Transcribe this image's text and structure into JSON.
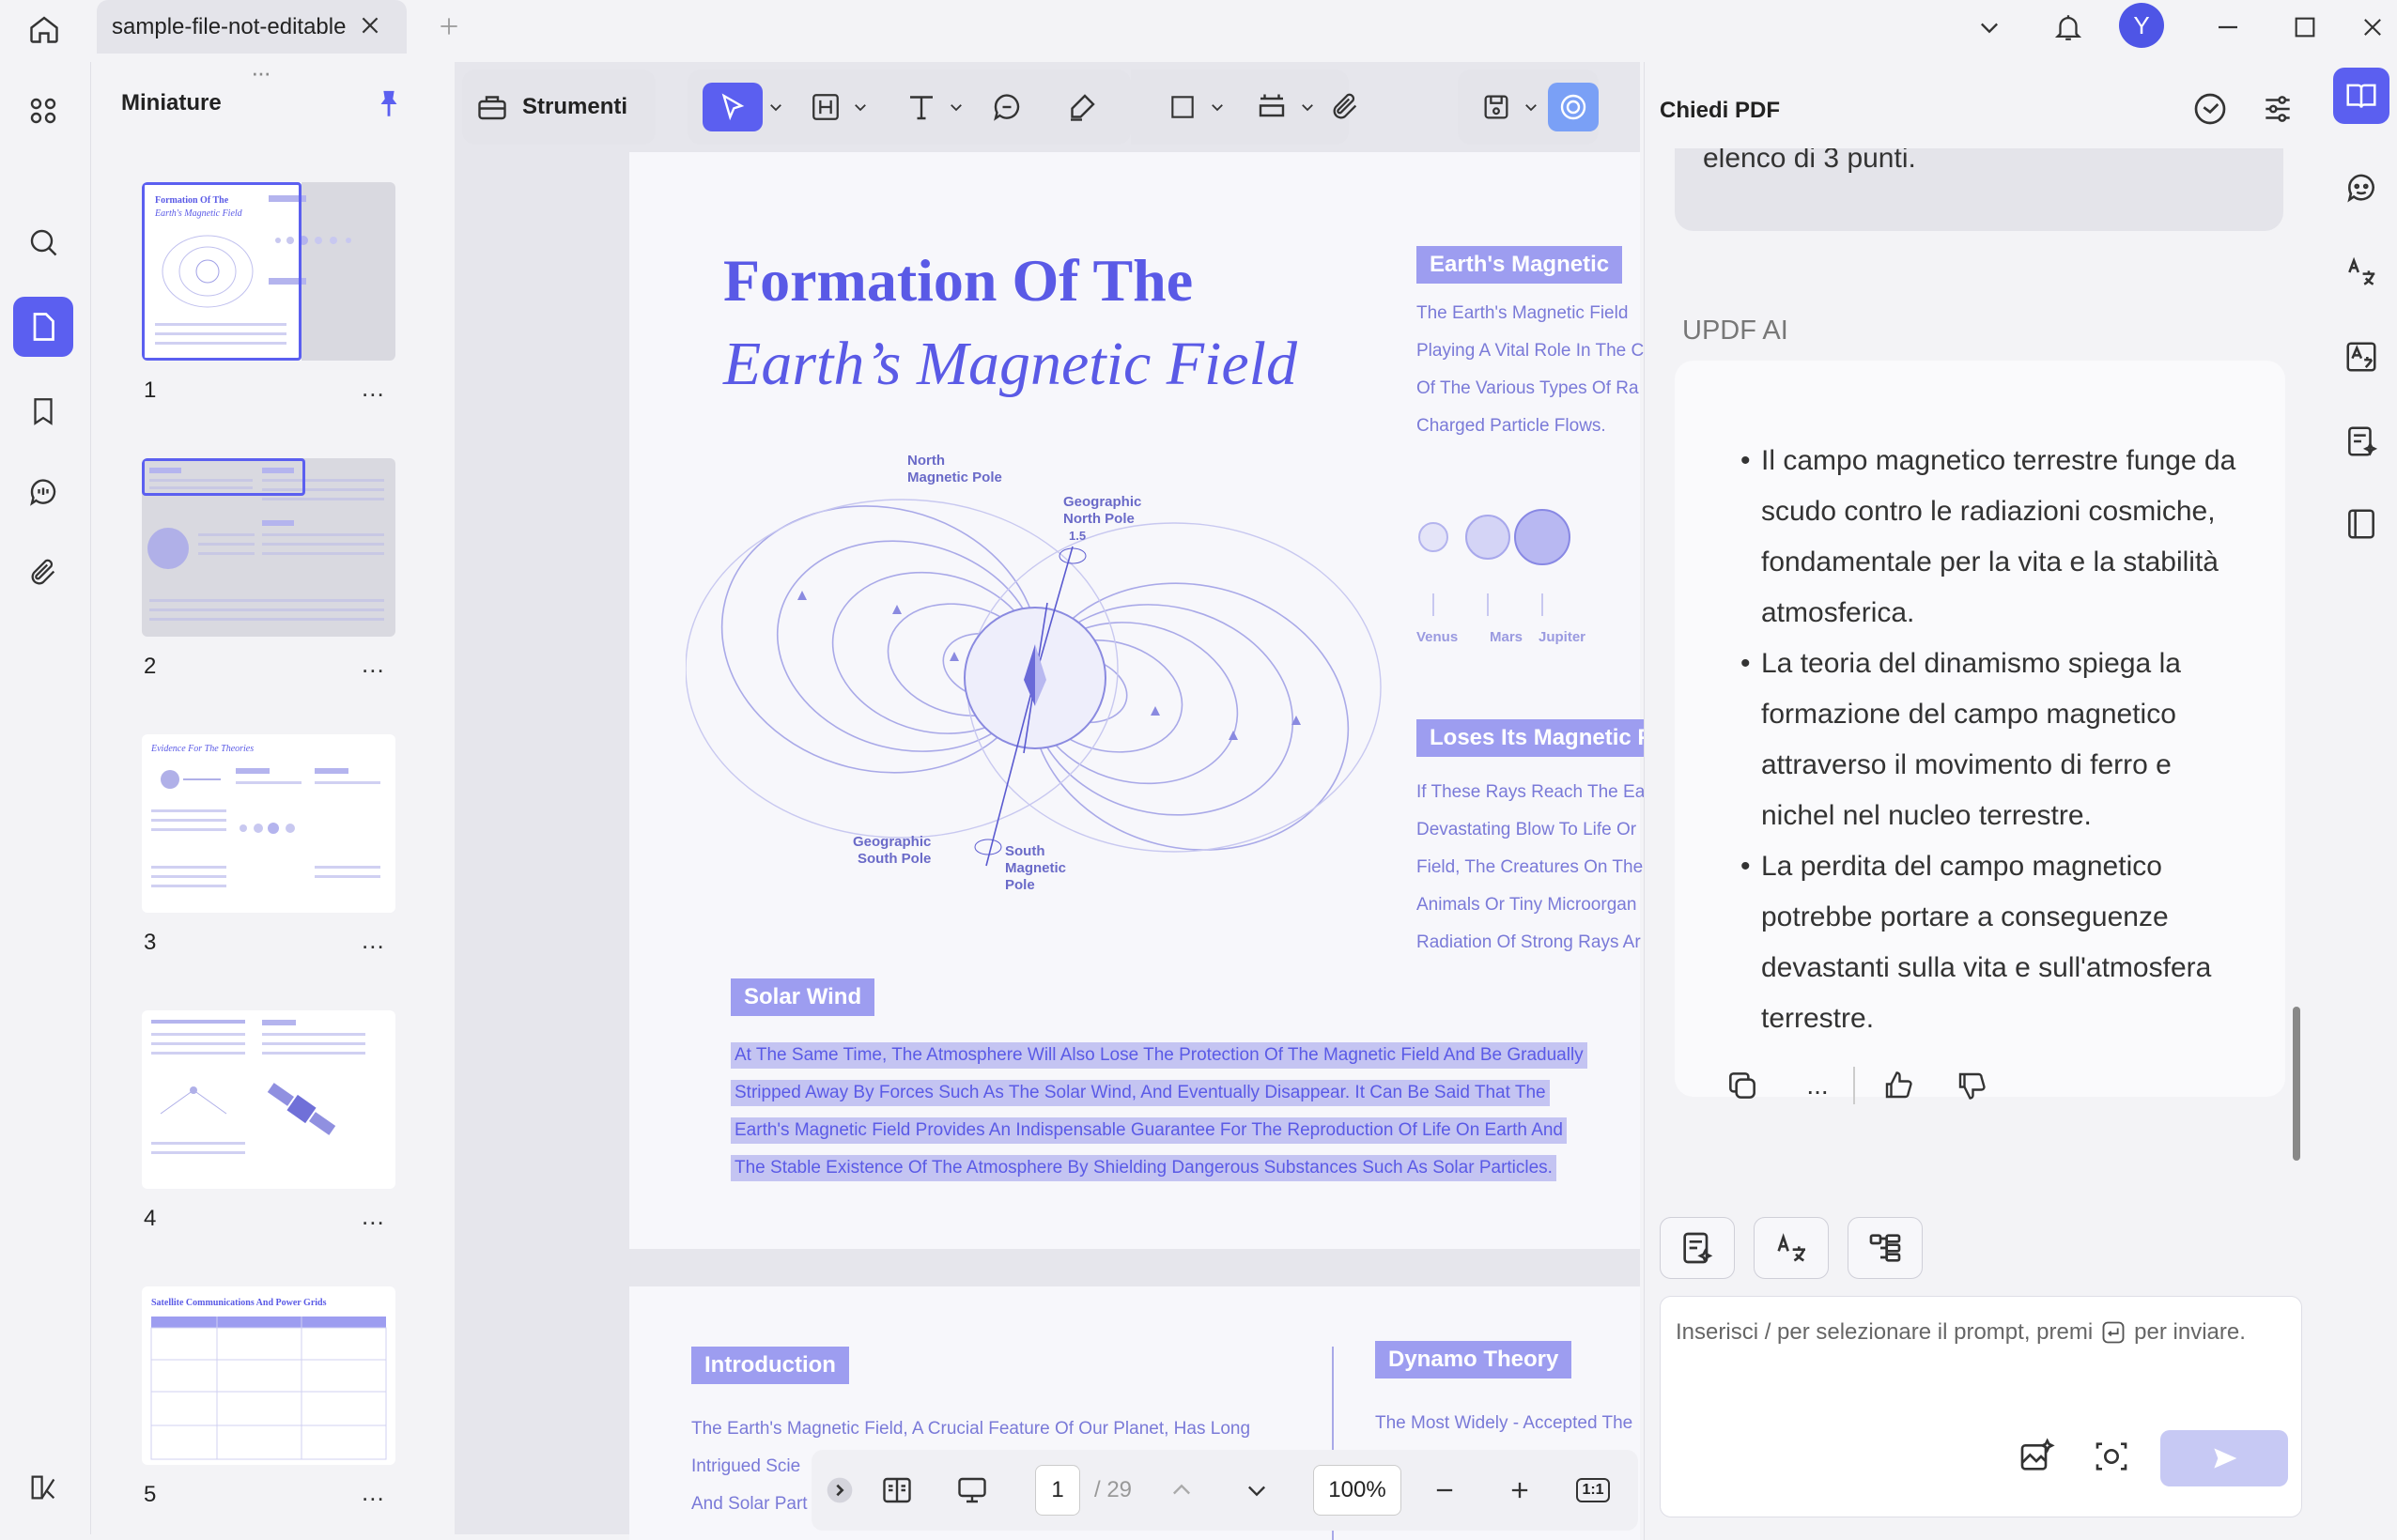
{
  "app": {
    "tab_title": "sample-file-not-editable"
  },
  "thumbnails": {
    "title": "Miniature",
    "pages": [
      {
        "number": "1",
        "more": "..."
      },
      {
        "number": "2",
        "more": "..."
      },
      {
        "number": "3",
        "more": "..."
      },
      {
        "number": "4",
        "more": "..."
      },
      {
        "number": "5",
        "more": "..."
      }
    ]
  },
  "toolbar": {
    "tools_label": "Strumenti"
  },
  "document": {
    "page1": {
      "title_line1": "Formation Of The",
      "title_line2": "Earth’s Magnetic Field",
      "diagram": {
        "north_magnetic_pole": "North\nMagnetic Pole",
        "geographic_north_pole": "Geographic\nNorth Pole",
        "geographic_south_pole": "Geographic\nSouth Pole",
        "south_magnetic_pole": "South\nMagnetic\nPole",
        "angle": "1.5"
      },
      "earths_magnetic": {
        "tag": "Earth's Magnetic",
        "lines": [
          "The Earth's Magnetic Field",
          "Playing A Vital Role In The C",
          "Of The Various Types Of Ra",
          "Charged Particle Flows."
        ]
      },
      "planets": [
        "Venus",
        "Mars",
        "Jupiter"
      ],
      "loses": {
        "tag": "Loses Its Magnetic Fi",
        "lines": [
          "If These Rays Reach The Ea",
          "Devastating Blow To Life Or",
          "Field, The Creatures On The",
          "Animals Or Tiny Microorgan",
          "Radiation Of Strong Rays Ar"
        ]
      },
      "solar_wind": {
        "tag": "Solar Wind",
        "lines": [
          "At The Same Time, The Atmosphere Will Also Lose The Protection Of The Magnetic Field And Be Gradually",
          "Stripped Away By Forces Such As The Solar Wind, And Eventually Disappear. It Can Be Said That The",
          "Earth's Magnetic Field Provides An Indispensable Guarantee For The Reproduction Of Life On Earth And",
          "The Stable Existence Of The Atmosphere By Shielding Dangerous Substances Such As Solar Particles."
        ]
      }
    },
    "page2": {
      "intro_tag": "Introduction",
      "intro_lines": [
        "The Earth's Magnetic Field, A Crucial Feature Of Our Planet, Has Long",
        "Intrigued Scie",
        "And Solar Part"
      ],
      "dynamo_tag": "Dynamo Theory",
      "dynamo_lines": [
        "The Most Widely - Accepted The"
      ]
    }
  },
  "bottom_nav": {
    "current_page": "1",
    "total_pages": "/ 29",
    "zoom": "100%",
    "fit_label": "1:1"
  },
  "ai_panel": {
    "title": "Chiedi PDF",
    "prev_message_tail": "elenco di 3 punti.",
    "assistant_label": "UPDF AI",
    "answer_bullets": [
      "Il campo magnetico terrestre funge da scudo contro le radiazioni cosmiche, fondamentale per la vita e la stabilità atmosferica.",
      "La teoria del dinamismo spiega la formazione del campo magnetico attraverso il movimento di ferro e nichel nel nucleo terrestre.",
      "La perdita del campo magnetico potrebbe portare a conseguenze devastanti sulla vita e sull'atmosfera terrestre."
    ],
    "more_label": "...",
    "input_placeholder_before": "Inserisci / per selezionare il prompt, premi",
    "input_placeholder_after": "per inviare."
  },
  "colors": {
    "accent": "#5b5ff0",
    "doc_purple": "#5a5ae6",
    "highlight": "#c4c4f2"
  }
}
